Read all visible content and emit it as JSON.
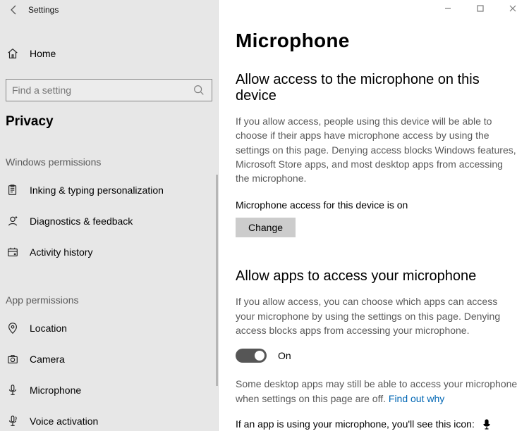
{
  "app": {
    "title": "Settings"
  },
  "home": {
    "label": "Home"
  },
  "search": {
    "placeholder": "Find a setting"
  },
  "section": {
    "title": "Privacy"
  },
  "groups": {
    "windows_permissions": {
      "label": "Windows permissions",
      "items": [
        {
          "label": "Inking & typing personalization"
        },
        {
          "label": "Diagnostics & feedback"
        },
        {
          "label": "Activity history"
        }
      ]
    },
    "app_permissions": {
      "label": "App permissions",
      "items": [
        {
          "label": "Location"
        },
        {
          "label": "Camera"
        },
        {
          "label": "Microphone"
        },
        {
          "label": "Voice activation"
        }
      ]
    }
  },
  "page": {
    "title": "Microphone",
    "device_access": {
      "heading": "Allow access to the microphone on this device",
      "desc": "If you allow access, people using this device will be able to choose if their apps have microphone access by using the settings on this page. Denying access blocks Windows features, Microsoft Store apps, and most desktop apps from accessing the microphone.",
      "status": "Microphone access for this device is on",
      "button": "Change"
    },
    "app_access": {
      "heading": "Allow apps to access your microphone",
      "desc": "If you allow access, you can choose which apps can access your microphone by using the settings on this page. Denying access blocks apps from accessing your microphone.",
      "toggle_state": "On",
      "note_pre": "Some desktop apps may still be able to access your microphone when settings on this page are off. ",
      "note_link": "Find out why",
      "indicator_line": "If an app is using your microphone, you'll see this icon:"
    }
  }
}
